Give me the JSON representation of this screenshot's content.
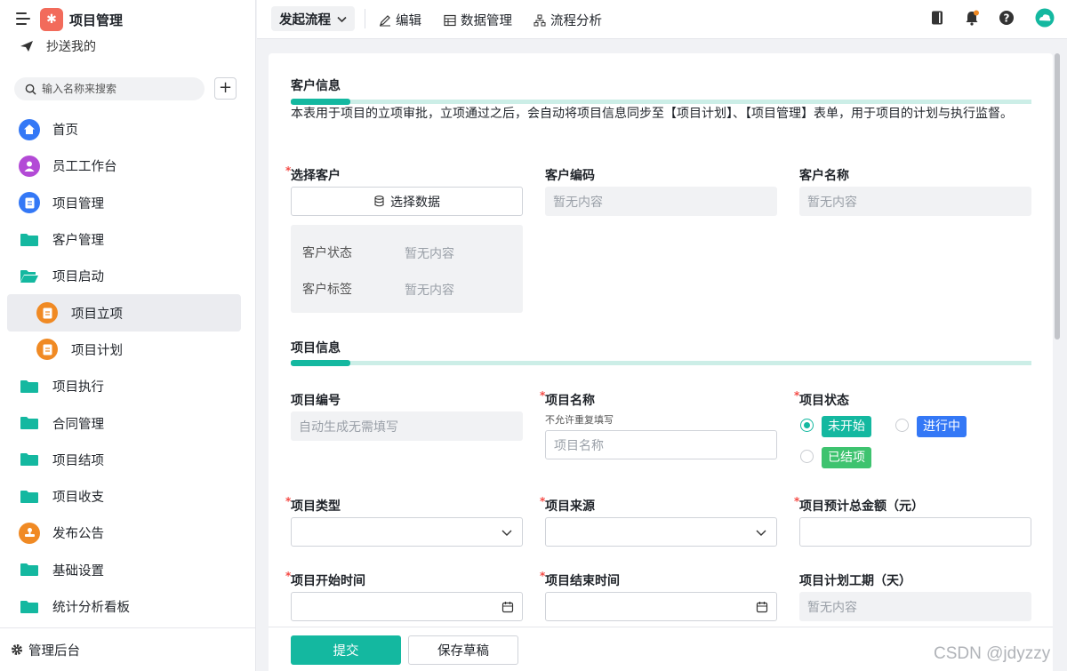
{
  "app": {
    "title": "项目管理"
  },
  "sidebar": {
    "cc_label": "抄送我的",
    "search_placeholder": "输入名称来搜索",
    "items": [
      {
        "label": "首页",
        "icon": "home-icon",
        "color": "#3478f6"
      },
      {
        "label": "员工工作台",
        "icon": "person-icon",
        "color": "#b34ad6"
      },
      {
        "label": "项目管理",
        "icon": "document-icon",
        "color": "#3478f6"
      },
      {
        "label": "客户管理",
        "icon": "folder-icon"
      },
      {
        "label": "项目启动",
        "icon": "folder-open-icon"
      },
      {
        "label": "项目立项",
        "icon": "document-icon",
        "color": "#f08a24"
      },
      {
        "label": "项目计划",
        "icon": "document-icon",
        "color": "#f08a24"
      },
      {
        "label": "项目执行",
        "icon": "folder-icon"
      },
      {
        "label": "合同管理",
        "icon": "folder-icon"
      },
      {
        "label": "项目结项",
        "icon": "folder-icon"
      },
      {
        "label": "项目收支",
        "icon": "folder-icon"
      },
      {
        "label": "发布公告",
        "icon": "stamp-icon",
        "color": "#f08a24"
      },
      {
        "label": "基础设置",
        "icon": "folder-icon"
      },
      {
        "label": "统计分析看板",
        "icon": "folder-icon"
      }
    ],
    "admin_label": "管理后台"
  },
  "topbar": {
    "start_label": "发起流程",
    "edit_label": "编辑",
    "data_label": "数据管理",
    "flow_label": "流程分析"
  },
  "colors": {
    "accent": "#14b8a0",
    "required": "#f54a45"
  },
  "customer_section": {
    "title": "客户信息",
    "description": "本表用于项目的立项审批，立项通过之后，会自动将项目信息同步至【项目计划】、【项目管理】表单，用于项目的计划与执行监督。",
    "select_customer_label": "选择客户",
    "select_data_label": "选择数据",
    "code_label": "客户编码",
    "code_value": "暂无内容",
    "name_label": "客户名称",
    "name_value": "暂无内容",
    "status_label": "客户状态",
    "status_value": "暂无内容",
    "tag_label": "客户标签",
    "tag_value": "暂无内容"
  },
  "project_section": {
    "title": "项目信息",
    "number_label": "项目编号",
    "number_placeholder": "自动生成无需填写",
    "name_label": "项目名称",
    "name_hint": "不允许重复填写",
    "name_placeholder": "项目名称",
    "status_label": "项目状态",
    "status_options": [
      {
        "label": "未开始",
        "color": "#14b8a0",
        "selected": true
      },
      {
        "label": "进行中",
        "color": "#3478f6",
        "selected": false
      },
      {
        "label": "已结项",
        "color": "#3ec36f",
        "selected": false
      }
    ],
    "type_label": "项目类型",
    "source_label": "项目来源",
    "budget_label": "项目预计总金额（元）",
    "start_label": "项目开始时间",
    "end_label": "项目结束时间",
    "duration_label": "项目计划工期（天）",
    "duration_value": "暂无内容"
  },
  "footer": {
    "submit_label": "提交",
    "draft_label": "保存草稿"
  },
  "watermark": "CSDN @jdyzzy"
}
